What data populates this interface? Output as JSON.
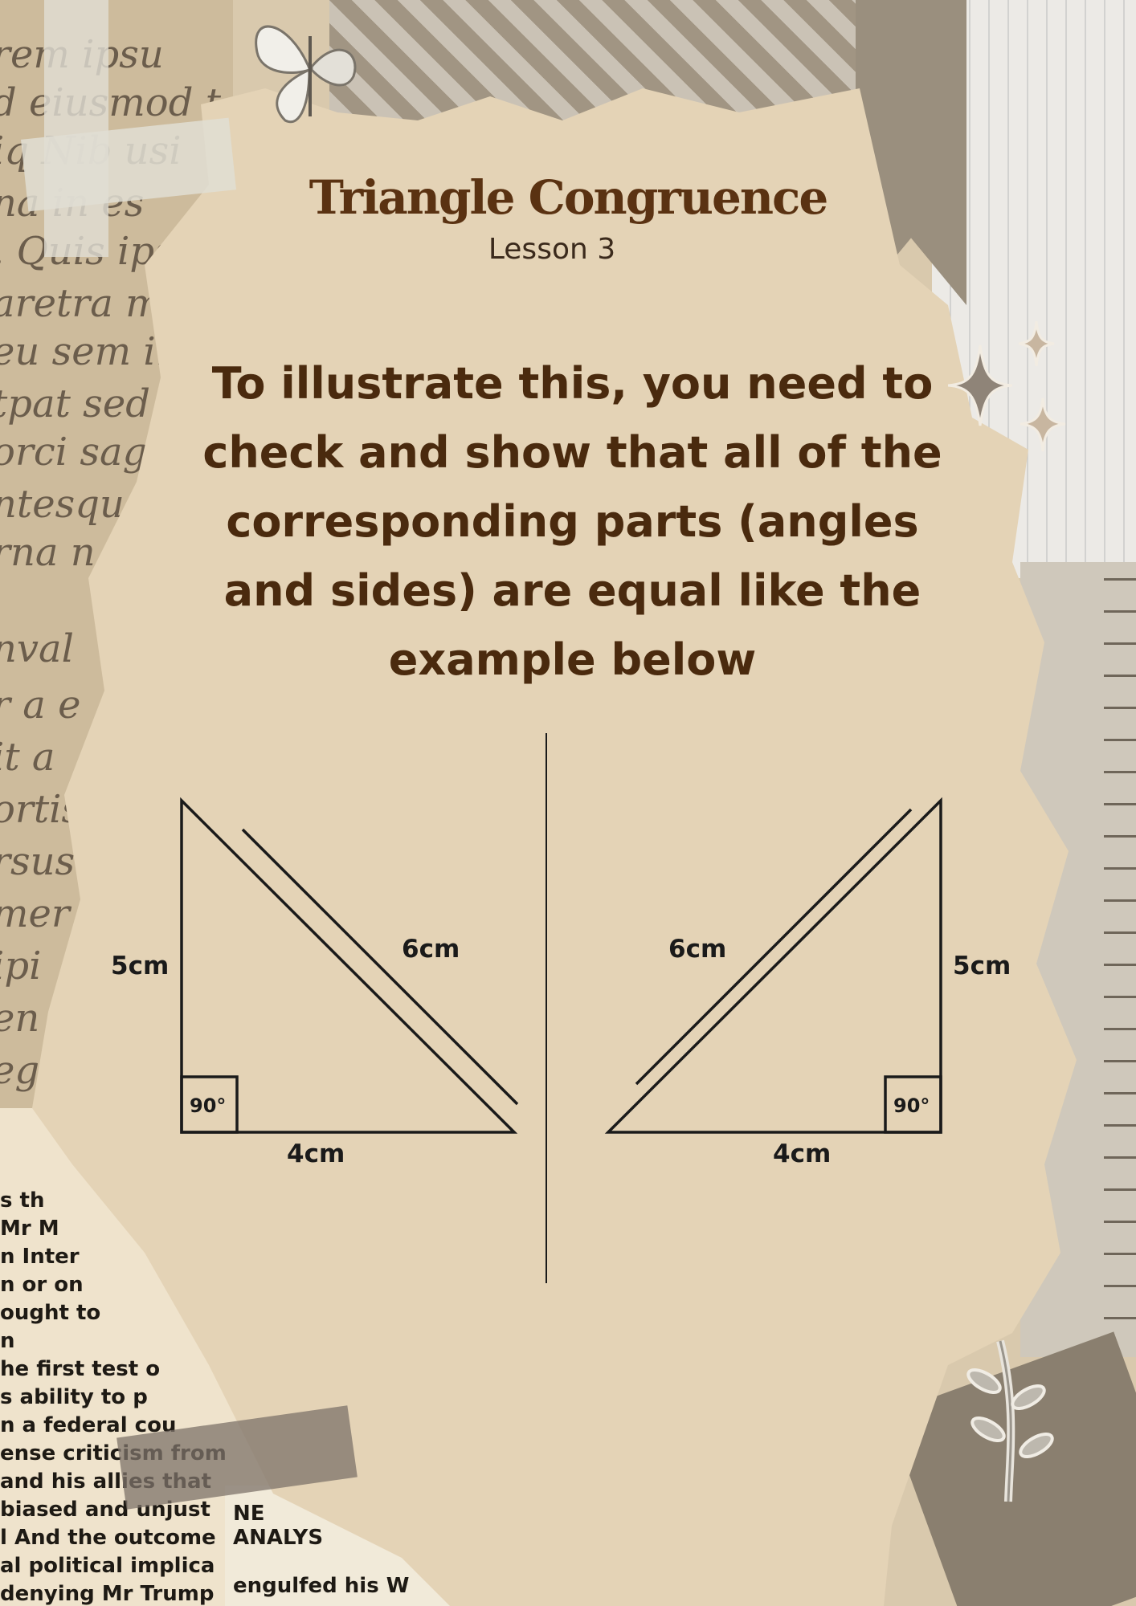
{
  "title": "Triangle Congruence",
  "subtitle": "Lesson 3",
  "body": "To illustrate this, you need to check and show that all of the corresponding parts (angles and sides) are equal like the example below",
  "diagram": {
    "left_triangle": {
      "side_vertical": "5cm",
      "side_hypotenuse": "6cm",
      "side_base": "4cm",
      "right_angle": "90°"
    },
    "right_triangle": {
      "side_vertical": "5cm",
      "side_hypotenuse": "6cm",
      "side_base": "4cm",
      "right_angle": "90°"
    }
  },
  "colors": {
    "title": "#5a3212",
    "body": "#4a2a0e",
    "paper": "#e4d3b6",
    "line": "#1a1a1a"
  }
}
